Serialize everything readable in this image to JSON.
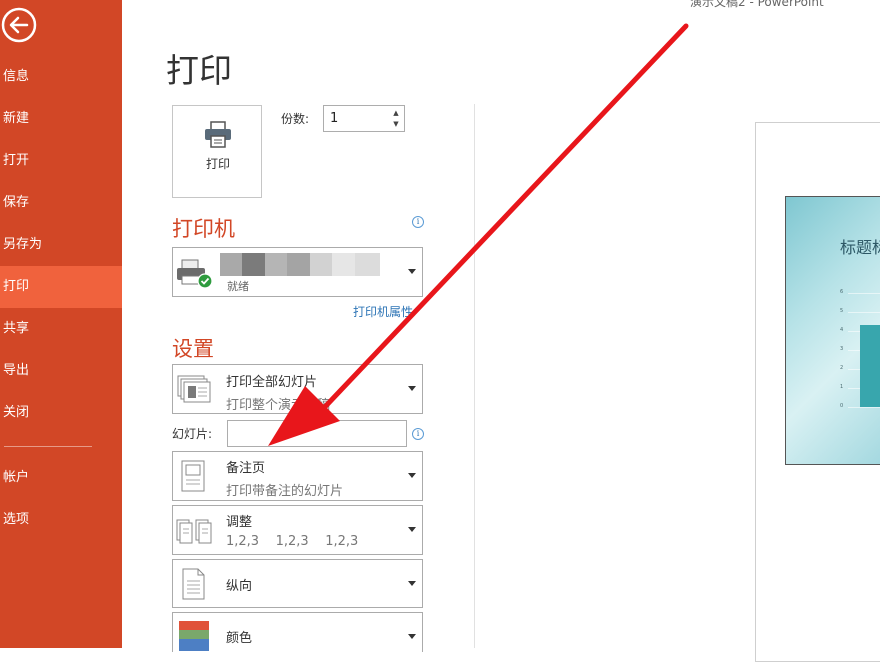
{
  "window": {
    "title_fragment": "演示文稿2 - PowerPoint"
  },
  "sidebar": {
    "items": [
      {
        "label": "信息"
      },
      {
        "label": "新建"
      },
      {
        "label": "打开"
      },
      {
        "label": "保存"
      },
      {
        "label": "另存为"
      },
      {
        "label": "打印",
        "active": true
      },
      {
        "label": "共享"
      },
      {
        "label": "导出"
      },
      {
        "label": "关闭"
      },
      {
        "label": "帐户"
      },
      {
        "label": "选项"
      }
    ],
    "colors": {
      "background": "#d24726",
      "active": "#f0623d"
    }
  },
  "page": {
    "title": "打印"
  },
  "print": {
    "button_label": "打印",
    "copies_label": "份数:",
    "copies_value": "1"
  },
  "printer": {
    "section_title": "打印机",
    "status": "就绪",
    "properties_link": "打印机属性"
  },
  "settings": {
    "section_title": "设置",
    "range": {
      "title": "打印全部幻灯片",
      "subtitle": "打印整个演示文稿"
    },
    "slides_label": "幻灯片:",
    "slides_value": "",
    "layout": {
      "title": "备注页",
      "subtitle": "打印带备注的幻灯片"
    },
    "collate": {
      "title": "调整",
      "subtitle": "1,2,3    1,2,3    1,2,3"
    },
    "orientation": {
      "title": "纵向"
    },
    "color": {
      "title": "颜色"
    }
  },
  "preview": {
    "slide_title": "标题标",
    "y_ticks": [
      "6",
      "5",
      "4",
      "3",
      "2",
      "1",
      "0"
    ]
  },
  "annotation": {
    "arrow_color": "#e8161b",
    "icon": "red-arrow-icon"
  }
}
